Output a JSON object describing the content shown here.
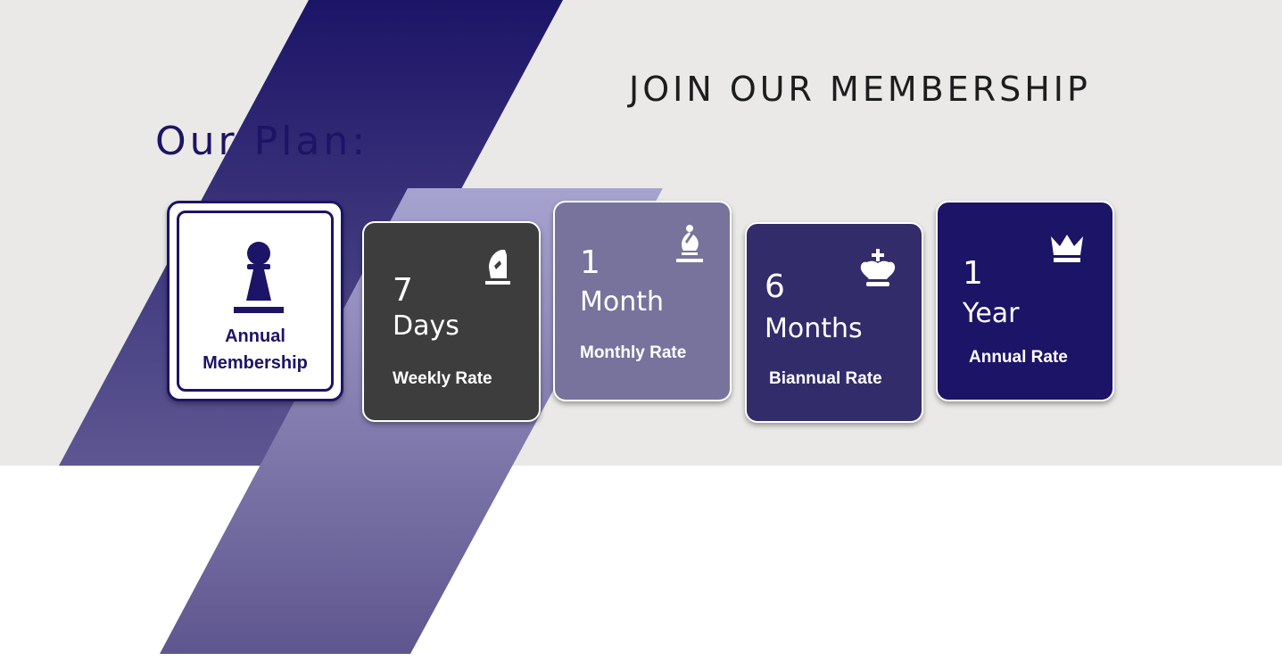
{
  "header": {
    "title": "JOIN OUR MEMBERSHIP",
    "subtitle": "Our Plan:"
  },
  "plans": [
    {
      "line1": "Annual",
      "line2": "Membership",
      "icon": "chess-pawn-icon"
    },
    {
      "number": "7",
      "unit": "Days",
      "rate": "Weekly Rate",
      "icon": "chess-knight-icon"
    },
    {
      "number": "1",
      "unit": "Month",
      "rate": "Monthly Rate",
      "icon": "chess-bishop-icon"
    },
    {
      "number": "6",
      "unit": "Months",
      "rate": "Biannual Rate",
      "icon": "chess-king-icon"
    },
    {
      "number": "1",
      "unit": "Year",
      "rate": "Annual Rate",
      "icon": "crown-icon"
    }
  ],
  "colors": {
    "navy": "#1c1466",
    "dark_grey": "#3d3d3d",
    "lavender": "#77739c",
    "indigo": "#332c6b",
    "background": "#eae9e7"
  }
}
